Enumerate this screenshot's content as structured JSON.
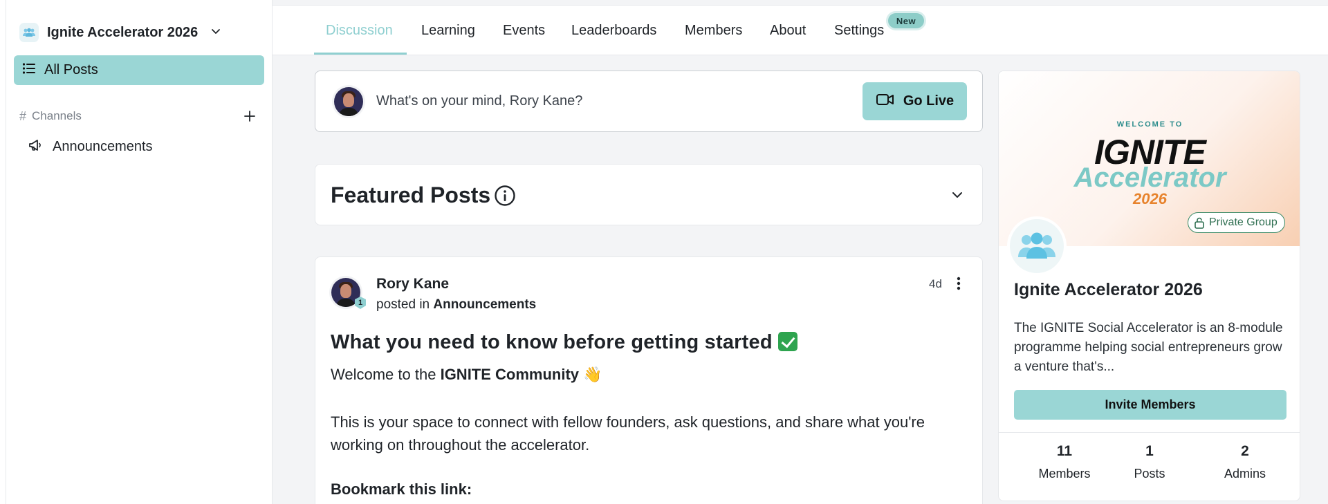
{
  "workspace": {
    "name": "Ignite Accelerator 2026"
  },
  "sidebar": {
    "all_posts_label": "All Posts",
    "channels_label": "Channels",
    "channels": [
      {
        "label": "Announcements",
        "icon": "megaphone-icon"
      }
    ]
  },
  "tabs": [
    {
      "label": "Discussion",
      "active": true
    },
    {
      "label": "Learning"
    },
    {
      "label": "Events"
    },
    {
      "label": "Leaderboards"
    },
    {
      "label": "Members"
    },
    {
      "label": "About"
    },
    {
      "label": "Settings",
      "badge": "New"
    }
  ],
  "composer": {
    "prompt": "What's on your mind, Rory Kane?",
    "go_live_label": "Go Live"
  },
  "featured": {
    "title": "Featured Posts"
  },
  "post": {
    "author": "Rory Kane",
    "level": "1",
    "posted_in_prefix": "posted in",
    "channel": "Announcements",
    "time": "4d",
    "title": "What you need to know before getting started",
    "welcome_prefix": "Welcome to the",
    "welcome_bold": "IGNITE Community",
    "welcome_emoji": "👋",
    "body": "This is your space to connect with fellow founders, ask questions, and share what you're working on throughout the accelerator.",
    "bookmark": "Bookmark this link:"
  },
  "group": {
    "banner_welcome": "WELCOME TO",
    "banner_title": "IGNITE",
    "banner_subtitle": "Accelerator",
    "banner_year": "2026",
    "privacy": "Private Group",
    "name": "Ignite Accelerator 2026",
    "description": "The IGNITE Social Accelerator is an 8-module programme helping social entrepreneurs grow a venture that's...",
    "invite_label": "Invite Members",
    "stats": [
      {
        "value": "11",
        "label": "Members"
      },
      {
        "value": "1",
        "label": "Posts"
      },
      {
        "value": "2",
        "label": "Admins"
      }
    ]
  },
  "colors": {
    "accent": "#9ad6d5",
    "active_tab": "#8fcfd0",
    "private_badge": "#3a8a66"
  }
}
